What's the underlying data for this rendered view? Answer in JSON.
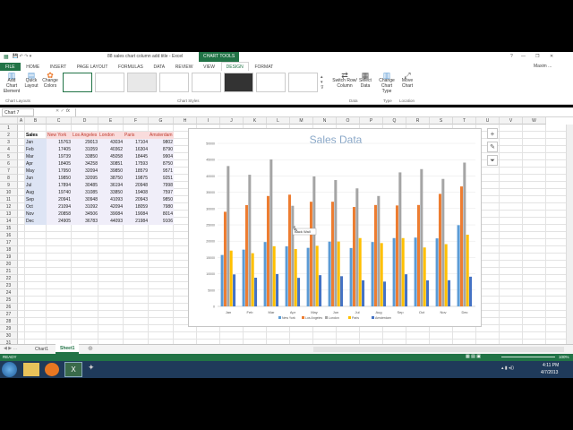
{
  "window": {
    "title": "88 sales chart column add title - Excel",
    "context_tab": "CHART TOOLS",
    "user": "Maxim ...",
    "controls": [
      "?",
      "—",
      "❐",
      "✕"
    ]
  },
  "tabs": [
    "FILE",
    "HOME",
    "INSERT",
    "PAGE LAYOUT",
    "FORMULAS",
    "DATA",
    "REVIEW",
    "VIEW",
    "DESIGN",
    "FORMAT"
  ],
  "active_tab": "DESIGN",
  "ribbon": {
    "buttons": {
      "add_chart": "Add Chart Element",
      "quick": "Quick Layout",
      "colors": "Change Colors",
      "switch": "Switch Row/ Column",
      "select": "Select Data",
      "change_type": "Change Chart Type",
      "move": "Move Chart"
    },
    "groups": {
      "layouts": "Chart Layouts",
      "styles": "Chart Styles",
      "data": "Data",
      "type": "Type",
      "location": "Location"
    }
  },
  "formula": {
    "name_box": "Chart 7",
    "fx": "fx",
    "value": ""
  },
  "columns": [
    "A",
    "B",
    "C",
    "D",
    "E",
    "F",
    "G",
    "H",
    "I",
    "J",
    "K",
    "L",
    "M",
    "N",
    "O",
    "P",
    "Q",
    "R",
    "S",
    "T",
    "U",
    "V",
    "W"
  ],
  "rows": [
    "1",
    "2",
    "3",
    "4",
    "5",
    "6",
    "7",
    "8",
    "9",
    "10",
    "11",
    "12",
    "13",
    "14",
    "15",
    "16",
    "17",
    "18",
    "19",
    "20",
    "21",
    "22",
    "23",
    "24",
    "25",
    "26",
    "27",
    "28",
    "29",
    "30",
    "31"
  ],
  "table": {
    "headers": [
      "Sales",
      "New York",
      "Los Angeles",
      "London",
      "Paris",
      "Amsterdam"
    ],
    "rows": [
      [
        "Jan",
        "15763",
        "29013",
        "43034",
        "17104",
        "9802"
      ],
      [
        "Feb",
        "17405",
        "31059",
        "40362",
        "16304",
        "8790"
      ],
      [
        "Mar",
        "19739",
        "33850",
        "45058",
        "18445",
        "9904"
      ],
      [
        "Apr",
        "18405",
        "34258",
        "30851",
        "17593",
        "8750"
      ],
      [
        "May",
        "17950",
        "32094",
        "39850",
        "18579",
        "9571"
      ],
      [
        "Jun",
        "19850",
        "32095",
        "38750",
        "19875",
        "9251"
      ],
      [
        "Jul",
        "17894",
        "30485",
        "36194",
        "20948",
        "7998"
      ],
      [
        "Aug",
        "19740",
        "31085",
        "33850",
        "19408",
        "7597"
      ],
      [
        "Sep",
        "20941",
        "30948",
        "41093",
        "20943",
        "9850"
      ],
      [
        "Oct",
        "21094",
        "31092",
        "42094",
        "18059",
        "7980"
      ],
      [
        "Nov",
        "20858",
        "34506",
        "39084",
        "19084",
        "8014"
      ],
      [
        "Dec",
        "24905",
        "36783",
        "44093",
        "21984",
        "9106"
      ]
    ]
  },
  "chart_data": {
    "type": "bar",
    "title": "Sales Data",
    "categories": [
      "Jan",
      "Feb",
      "Mar",
      "Apr",
      "May",
      "Jun",
      "Jul",
      "Aug",
      "Sep",
      "Oct",
      "Nov",
      "Dec"
    ],
    "series": [
      {
        "name": "New York",
        "color": "#5b9bd5",
        "values": [
          15763,
          17405,
          19739,
          18405,
          17950,
          19850,
          17894,
          19740,
          20941,
          21094,
          20858,
          24905
        ]
      },
      {
        "name": "Los Angeles",
        "color": "#ed7d31",
        "values": [
          29013,
          31059,
          33850,
          34258,
          32094,
          32095,
          30485,
          31085,
          30948,
          31092,
          34506,
          36783
        ]
      },
      {
        "name": "London",
        "color": "#a5a5a5",
        "values": [
          43034,
          40362,
          45058,
          30851,
          39850,
          38750,
          36194,
          33850,
          41093,
          42094,
          39084,
          44093
        ]
      },
      {
        "name": "Paris",
        "color": "#ffc000",
        "values": [
          17104,
          16304,
          18445,
          17593,
          18579,
          19875,
          20948,
          19408,
          20943,
          18059,
          19084,
          21984
        ]
      },
      {
        "name": "Amsterdam",
        "color": "#4472c4",
        "values": [
          9802,
          8790,
          9904,
          8750,
          9571,
          9251,
          7998,
          7597,
          9850,
          7980,
          8014,
          9106
        ]
      }
    ],
    "ylim": [
      0,
      50000
    ],
    "yticks": [
      "50000",
      "45000",
      "40000",
      "35000",
      "30000",
      "25000",
      "20000",
      "15000",
      "10000",
      "5000",
      "0"
    ],
    "legend": "bottom",
    "tooltip": "Back Wall"
  },
  "sheet_tabs": [
    "Chart1",
    "Sheet1"
  ],
  "active_sheet": "Sheet1",
  "status": {
    "left": "READY",
    "zoom": "100%"
  },
  "taskbar": {
    "time": "4:11 PM",
    "date": "4/7/2013"
  }
}
